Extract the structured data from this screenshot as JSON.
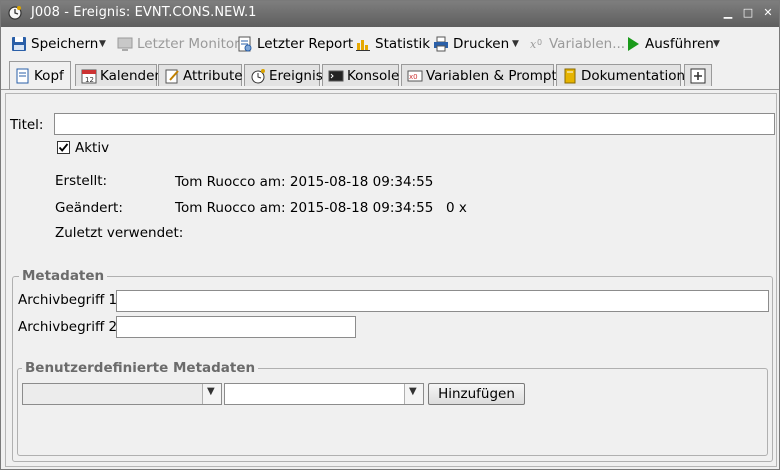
{
  "window": {
    "title": "J008 - Ereignis: EVNT.CONS.NEW.1"
  },
  "toolbar": {
    "save": "Speichern",
    "last_monitor": "Letzter Monitor",
    "last_report": "Letzter Report",
    "statistics": "Statistik",
    "print": "Drucken",
    "variables": "Variablen...",
    "execute": "Ausführen"
  },
  "tabs": [
    {
      "label": "Kopf",
      "icon": "header-doc-icon",
      "active": true
    },
    {
      "label": "Kalender",
      "icon": "calendar-icon"
    },
    {
      "label": "Attribute",
      "icon": "attributes-icon"
    },
    {
      "label": "Ereignis",
      "icon": "event-icon"
    },
    {
      "label": "Konsole",
      "icon": "console-icon"
    },
    {
      "label": "Variablen & Prompts",
      "icon": "variables-icon"
    },
    {
      "label": "Dokumentation",
      "icon": "documentation-icon"
    },
    {
      "label": "+",
      "icon": "add-tab-icon"
    }
  ],
  "form": {
    "title_label": "Titel:",
    "title_value": "",
    "active_label": "Aktiv",
    "active_checked": true,
    "created_label": "Erstellt:",
    "created_value": "Tom Ruocco am: 2015-08-18 09:34:55",
    "modified_label": "Geändert:",
    "modified_value": "Tom Ruocco am: 2015-08-18 09:34:55",
    "modified_count": "0 x",
    "last_used_label": "Zuletzt verwendet:",
    "last_used_value": ""
  },
  "metadata": {
    "legend": "Metadaten",
    "archive1_label": "Archivbegriff 1:",
    "archive1_value": "",
    "archive2_label": "Archivbegriff 2:",
    "archive2_value": "",
    "custom_legend": "Benutzerdefinierte Metadaten",
    "combo1_value": "",
    "combo2_value": "",
    "add_button": "Hinzufügen"
  }
}
